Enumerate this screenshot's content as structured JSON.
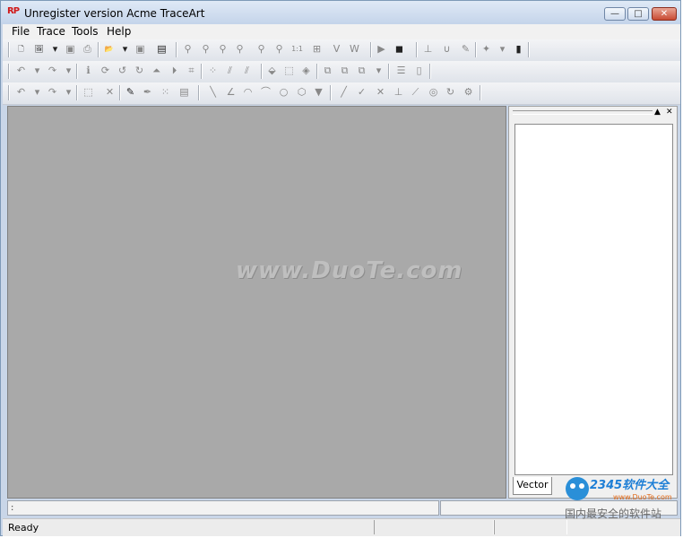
{
  "window": {
    "title": "Unregister version Acme TraceArt",
    "app_icon_glyph": "RP",
    "controls": {
      "minimize": "—",
      "maximize": "□",
      "close": "✕"
    }
  },
  "menu": {
    "items": [
      "File",
      "Trace",
      "Tools",
      "Help"
    ]
  },
  "toolbar1": {
    "buttons": [
      {
        "icon": "new-document-icon",
        "glyph": "🗋",
        "enabled": true
      },
      {
        "icon": "open-image-icon",
        "glyph": "🖼",
        "enabled": true
      },
      {
        "icon": "dropdown-icon",
        "glyph": "▾",
        "enabled": true
      },
      {
        "icon": "save-icon",
        "glyph": "▣",
        "enabled": false
      },
      {
        "icon": "print-icon",
        "glyph": "⎙",
        "enabled": false
      },
      {
        "icon": "open-folder-icon",
        "glyph": "📂",
        "enabled": true
      },
      {
        "icon": "dropdown-icon",
        "glyph": "▾",
        "enabled": true
      },
      {
        "icon": "save-vector-icon",
        "glyph": "▣",
        "enabled": false
      },
      {
        "icon": "export-icon",
        "glyph": "▤",
        "enabled": true
      },
      {
        "icon": "zoom-icon",
        "glyph": "⚲",
        "enabled": false
      },
      {
        "icon": "zoom-in-icon",
        "glyph": "⚲",
        "enabled": false
      },
      {
        "icon": "zoom-out-icon",
        "glyph": "⚲",
        "enabled": false
      },
      {
        "icon": "zoom-fit-icon",
        "glyph": "⚲",
        "enabled": false
      },
      {
        "icon": "zoom-area-icon",
        "glyph": "⚲",
        "enabled": false
      },
      {
        "icon": "zoom-selection-icon",
        "glyph": "⚲",
        "enabled": false
      },
      {
        "icon": "zoom-actual-icon",
        "glyph": "1:1",
        "enabled": false
      },
      {
        "icon": "fit-page-icon",
        "glyph": "⊞",
        "enabled": false
      },
      {
        "icon": "fit-height-icon",
        "glyph": "V",
        "enabled": false
      },
      {
        "icon": "fit-width-icon",
        "glyph": "W",
        "enabled": false
      },
      {
        "icon": "run-trace-icon",
        "glyph": "▶",
        "enabled": false
      },
      {
        "icon": "trace-wizard-icon",
        "glyph": "◼",
        "enabled": true
      },
      {
        "icon": "crop-icon",
        "glyph": "⊥",
        "enabled": false
      },
      {
        "icon": "magnet-icon",
        "glyph": "∪",
        "enabled": false
      },
      {
        "icon": "eyedropper-icon",
        "glyph": "✎",
        "enabled": false
      },
      {
        "icon": "color-tool-icon",
        "glyph": "✦",
        "enabled": false
      },
      {
        "icon": "dropdown-icon",
        "glyph": "▾",
        "enabled": false
      },
      {
        "icon": "histogram-icon",
        "glyph": "▮",
        "enabled": true
      }
    ]
  },
  "toolbar2": {
    "buttons": [
      {
        "icon": "undo-icon",
        "glyph": "↶"
      },
      {
        "icon": "dropdown-icon",
        "glyph": "▾"
      },
      {
        "icon": "redo-icon",
        "glyph": "↷"
      },
      {
        "icon": "dropdown-icon",
        "glyph": "▾"
      },
      {
        "icon": "info-icon",
        "glyph": "ℹ"
      },
      {
        "icon": "rotate-free-icon",
        "glyph": "⟳"
      },
      {
        "icon": "rotate-left-icon",
        "glyph": "↺"
      },
      {
        "icon": "rotate-right-icon",
        "glyph": "↻"
      },
      {
        "icon": "flip-vertical-icon",
        "glyph": "⏶"
      },
      {
        "icon": "flip-horizontal-icon",
        "glyph": "⏵"
      },
      {
        "icon": "crop-image-icon",
        "glyph": "⌗"
      },
      {
        "icon": "despeckle-icon",
        "glyph": "⁘"
      },
      {
        "icon": "smooth-icon",
        "glyph": "⫽"
      },
      {
        "icon": "sharpen-icon",
        "glyph": "⫽"
      },
      {
        "icon": "fill-icon",
        "glyph": "⬙"
      },
      {
        "icon": "erase-icon",
        "glyph": "⬚"
      },
      {
        "icon": "bucket-icon",
        "glyph": "◈"
      },
      {
        "icon": "layers-icon",
        "glyph": "⧉"
      },
      {
        "icon": "layers-merge-icon",
        "glyph": "⧉"
      },
      {
        "icon": "layers-split-icon",
        "glyph": "⧉"
      },
      {
        "icon": "dropdown-icon",
        "glyph": "▾"
      },
      {
        "icon": "line-width-icon",
        "glyph": "☰"
      },
      {
        "icon": "page-icon",
        "glyph": "▯"
      }
    ]
  },
  "toolbar3": {
    "buttons": [
      {
        "icon": "undo-icon",
        "glyph": "↶"
      },
      {
        "icon": "dropdown-icon",
        "glyph": "▾"
      },
      {
        "icon": "redo-icon",
        "glyph": "↷"
      },
      {
        "icon": "dropdown-icon",
        "glyph": "▾"
      },
      {
        "icon": "select-area-icon",
        "glyph": "⬚"
      },
      {
        "icon": "delete-icon",
        "glyph": "✕"
      },
      {
        "icon": "node-edit-icon",
        "glyph": "✎",
        "enabled": true
      },
      {
        "icon": "pen-icon",
        "glyph": "✒"
      },
      {
        "icon": "node-grid-icon",
        "glyph": "⁙"
      },
      {
        "icon": "group-icon",
        "glyph": "▤"
      },
      {
        "icon": "line-tool-icon",
        "glyph": "╲"
      },
      {
        "icon": "bezier-icon",
        "glyph": "∠"
      },
      {
        "icon": "arc-icon",
        "glyph": "◠"
      },
      {
        "icon": "curve-icon",
        "glyph": "⌒"
      },
      {
        "icon": "circle-icon",
        "glyph": "○"
      },
      {
        "icon": "polygon-icon",
        "glyph": "⬡"
      },
      {
        "icon": "triangle-icon",
        "glyph": "▼"
      },
      {
        "icon": "line-segment-icon",
        "glyph": "╱"
      },
      {
        "icon": "check-line-icon",
        "glyph": "✓"
      },
      {
        "icon": "cross-icon",
        "glyph": "✕"
      },
      {
        "icon": "perpendicular-icon",
        "glyph": "⊥"
      },
      {
        "icon": "tangent-icon",
        "glyph": "⟋"
      },
      {
        "icon": "center-icon",
        "glyph": "◎"
      },
      {
        "icon": "rotate-shape-icon",
        "glyph": "↻"
      },
      {
        "icon": "settings-shape-icon",
        "glyph": "⚙"
      }
    ]
  },
  "workspace": {
    "watermark": "www.DuoTe.com"
  },
  "panel": {
    "tab_label": "Vector",
    "pin_glyph": "▲",
    "close_glyph": "✕"
  },
  "statusbar": {
    "coords_field": ":",
    "status": "Ready"
  },
  "logo": {
    "brand": "2345软件大全",
    "url": "www.DuoTe.com",
    "tagline": "国内最安全的软件站"
  }
}
